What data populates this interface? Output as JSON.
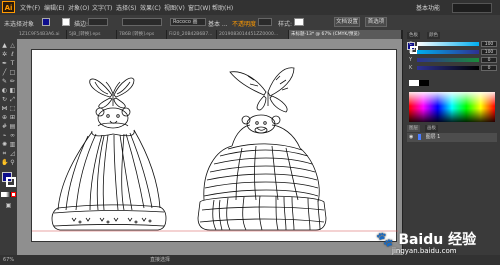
{
  "app": {
    "logo_text": "Ai"
  },
  "menu": {
    "items": [
      "文件(F)",
      "编辑(E)",
      "对象(O)",
      "文字(T)",
      "选择(S)",
      "效果(C)",
      "视图(V)",
      "窗口(W)",
      "帮助(H)"
    ]
  },
  "workspace": {
    "label": "基本功能"
  },
  "control": {
    "selection_label": "未选择对象",
    "stroke_label": "描边:",
    "brush_value": "Rococo 画",
    "style_label": "基本 ...",
    "opacity_label": "不透明度",
    "style2_label": "样式:",
    "doc_setup": "文档设置",
    "prefs": "首选项"
  },
  "tabs": [
    {
      "label": "1Z1C9F54B3A6.ai"
    },
    {
      "label": "5JB_[转换].eps"
    },
    {
      "label": "7B6B [转换].eps"
    },
    {
      "label": "Fil20_20B42B6B7..."
    },
    {
      "label": "2019083014451ZZ0000..."
    },
    {
      "label": "未标题-13* @ 67% (CMYK/预览)"
    }
  ],
  "status": {
    "zoom": "67%",
    "tool_name": "直接选择"
  },
  "panels": {
    "tab_labels": [
      "色板",
      "颜色"
    ],
    "channels": [
      {
        "name": "C",
        "value": "100"
      },
      {
        "name": "M",
        "value": "100"
      },
      {
        "name": "Y",
        "value": "0"
      },
      {
        "name": "K",
        "value": "0"
      }
    ],
    "layers_tabs": [
      "图层",
      "画板"
    ],
    "layer_name": "图层 1"
  },
  "colors": {
    "fill": "#0d0d8c",
    "accent": "#ff9a00"
  },
  "watermark": {
    "brand": "Baidu 经验",
    "url": "jingyan.baidu.com"
  }
}
